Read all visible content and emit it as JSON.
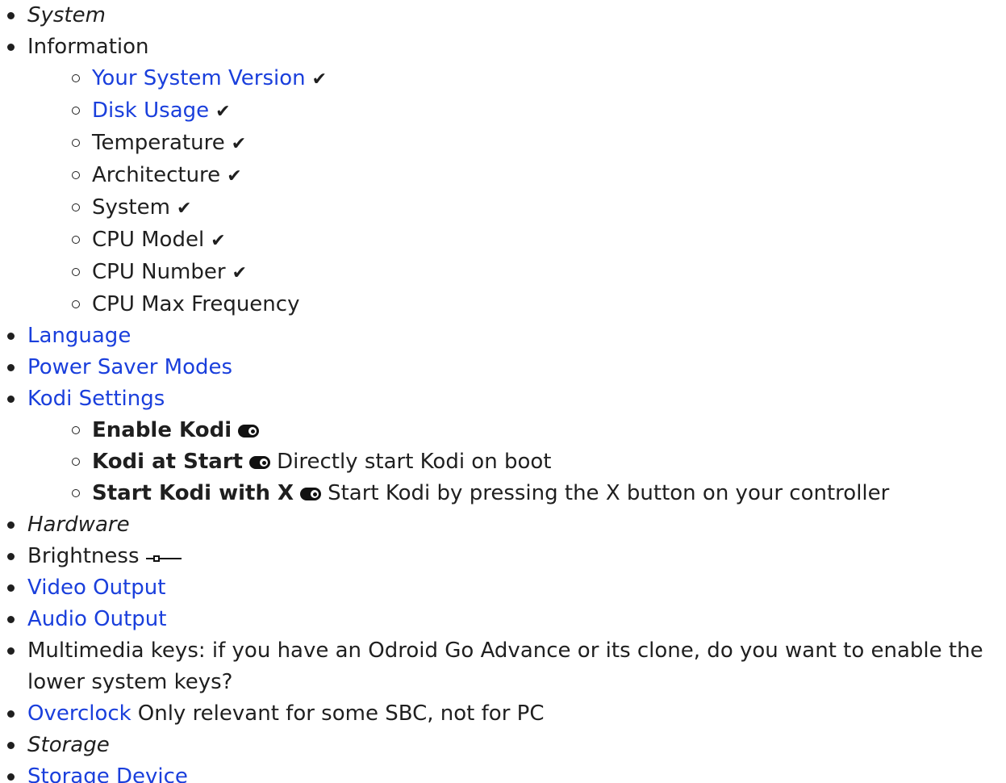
{
  "items": {
    "system_header": "System",
    "information": "Information",
    "information_sub": {
      "your_system_version": "Your System Version",
      "disk_usage": "Disk Usage",
      "temperature": "Temperature",
      "architecture": "Architecture",
      "system": "System",
      "cpu_model": "CPU Model",
      "cpu_number": "CPU Number",
      "cpu_max_frequency": "CPU Max Frequency"
    },
    "check_mark": "✔",
    "language": "Language",
    "power_saver_modes": "Power Saver Modes",
    "kodi_settings": "Kodi Settings",
    "kodi_sub": {
      "enable_kodi": "Enable Kodi",
      "kodi_at_start": "Kodi at Start",
      "kodi_at_start_desc": "Directly start Kodi on boot",
      "start_kodi_with_x": "Start Kodi with X",
      "start_kodi_with_x_desc": "Start Kodi by pressing the X button on your controller"
    },
    "hardware_header": "Hardware",
    "brightness": "Brightness",
    "brightness_level": 0.25,
    "video_output": "Video Output",
    "audio_output": "Audio Output",
    "multimedia_keys": "Multimedia keys: if you have an Odroid Go Advance or its clone, do you want to enable the lower system keys?",
    "overclock": "Overclock",
    "overclock_desc": "Only relevant for some SBC, not for PC",
    "storage_header": "Storage",
    "storage_device": "Storage Device"
  },
  "icons": {
    "toggle": "toggle-icon",
    "slider": "slider-icon",
    "check": "check-icon"
  },
  "colors": {
    "link": "#1a3fdc",
    "text": "#1f1f1f"
  }
}
